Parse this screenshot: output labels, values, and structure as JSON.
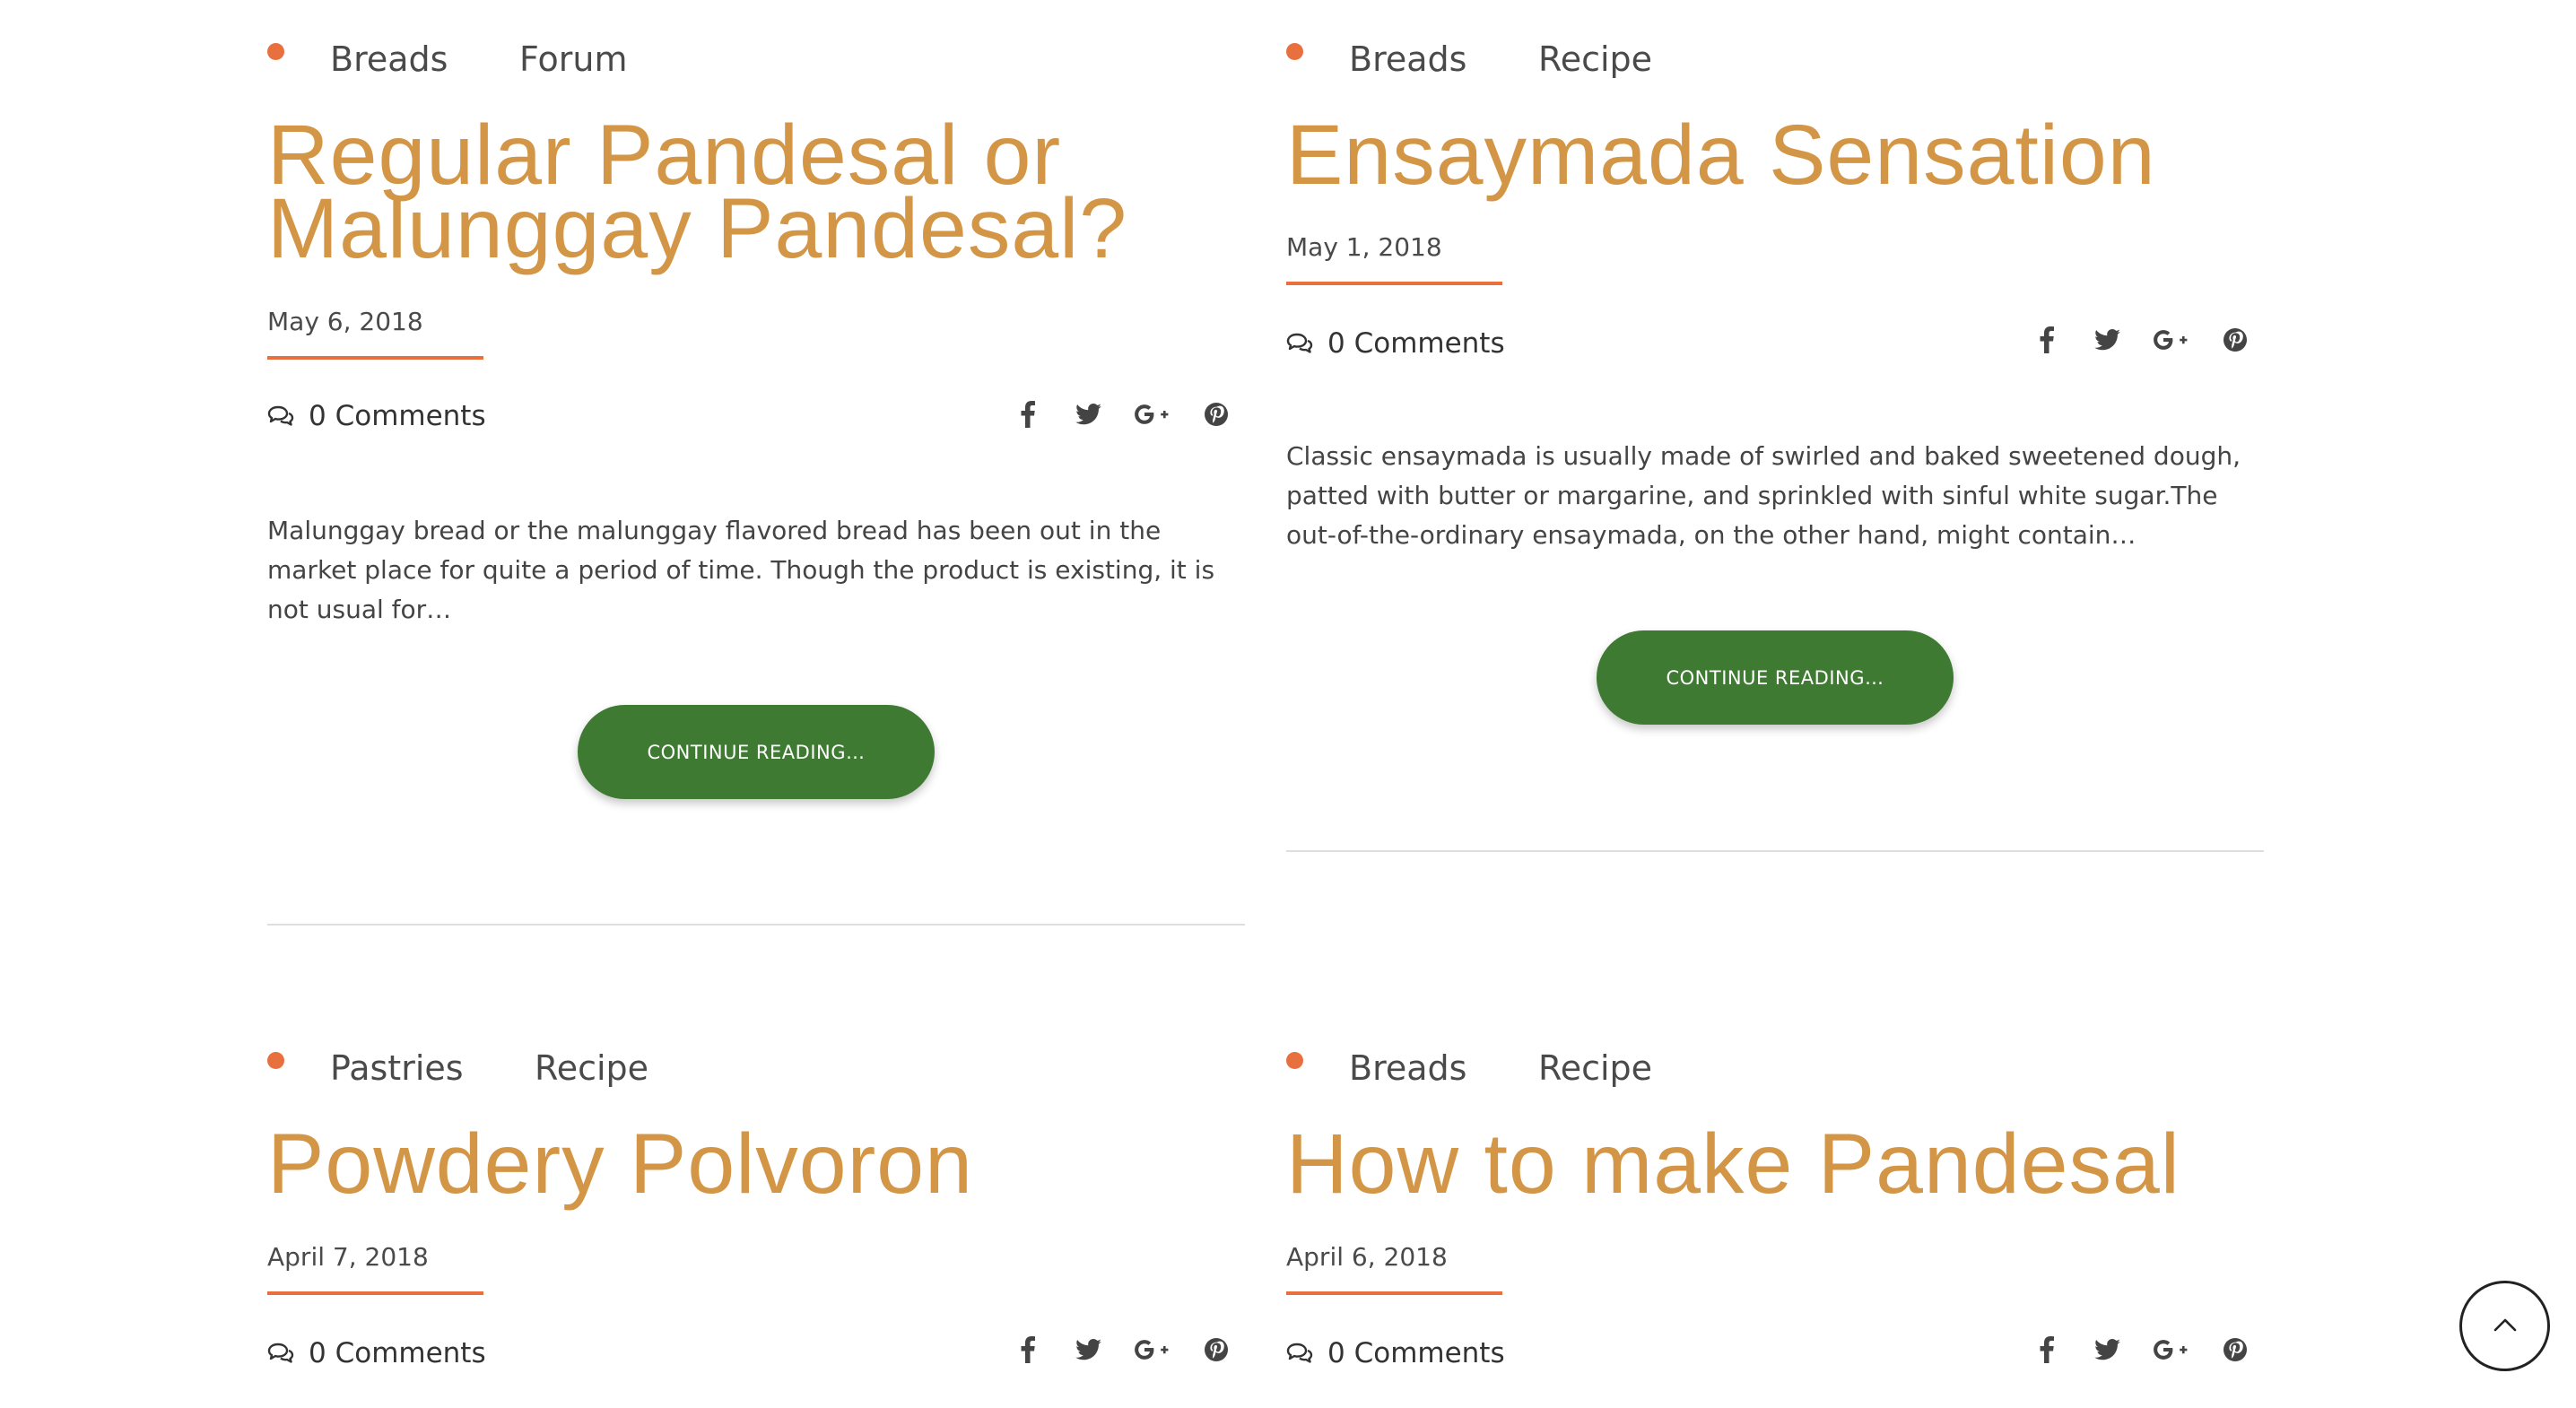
{
  "posts": [
    {
      "categories": [
        "Breads",
        "Forum"
      ],
      "title_lines": [
        "Regular Pandesal or",
        "Malunggay Pandesal?"
      ],
      "date": "May 6, 2018",
      "comments": "0 Comments",
      "excerpt_lines": [
        "Malunggay bread or the malunggay flavored bread has been out in the",
        "market place for quite a period of time. Though the product is existing, it is",
        "not usual for…"
      ],
      "button": "CONTINUE READING…"
    },
    {
      "categories": [
        "Breads",
        "Recipe"
      ],
      "title_lines": [
        "Ensaymada Sensation"
      ],
      "date": "May 1, 2018",
      "comments": "0 Comments",
      "excerpt_lines": [
        "Classic ensaymada is usually made of swirled and baked sweetened dough,",
        "patted with butter or margarine, and sprinkled with sinful white sugar.The",
        "out-of-the-ordinary ensaymada, on the other hand, might contain…"
      ],
      "button": "CONTINUE READING…"
    },
    {
      "categories": [
        "Pastries",
        "Recipe"
      ],
      "title_lines": [
        "Powdery Polvoron"
      ],
      "date": "April 7, 2018",
      "comments": "0 Comments"
    },
    {
      "categories": [
        "Breads",
        "Recipe"
      ],
      "title_lines": [
        "How to make Pandesal"
      ],
      "date": "April 6, 2018",
      "comments": "0 Comments"
    }
  ],
  "share_icons": [
    "facebook-icon",
    "twitter-icon",
    "google-plus-icon",
    "pinterest-icon"
  ],
  "colors": {
    "title": "#d39646",
    "accent": "#e8703f",
    "button": "#3f7a33",
    "text": "#444444",
    "separator": "#dedede"
  },
  "scroll_top_icon": "chevron-up-icon"
}
